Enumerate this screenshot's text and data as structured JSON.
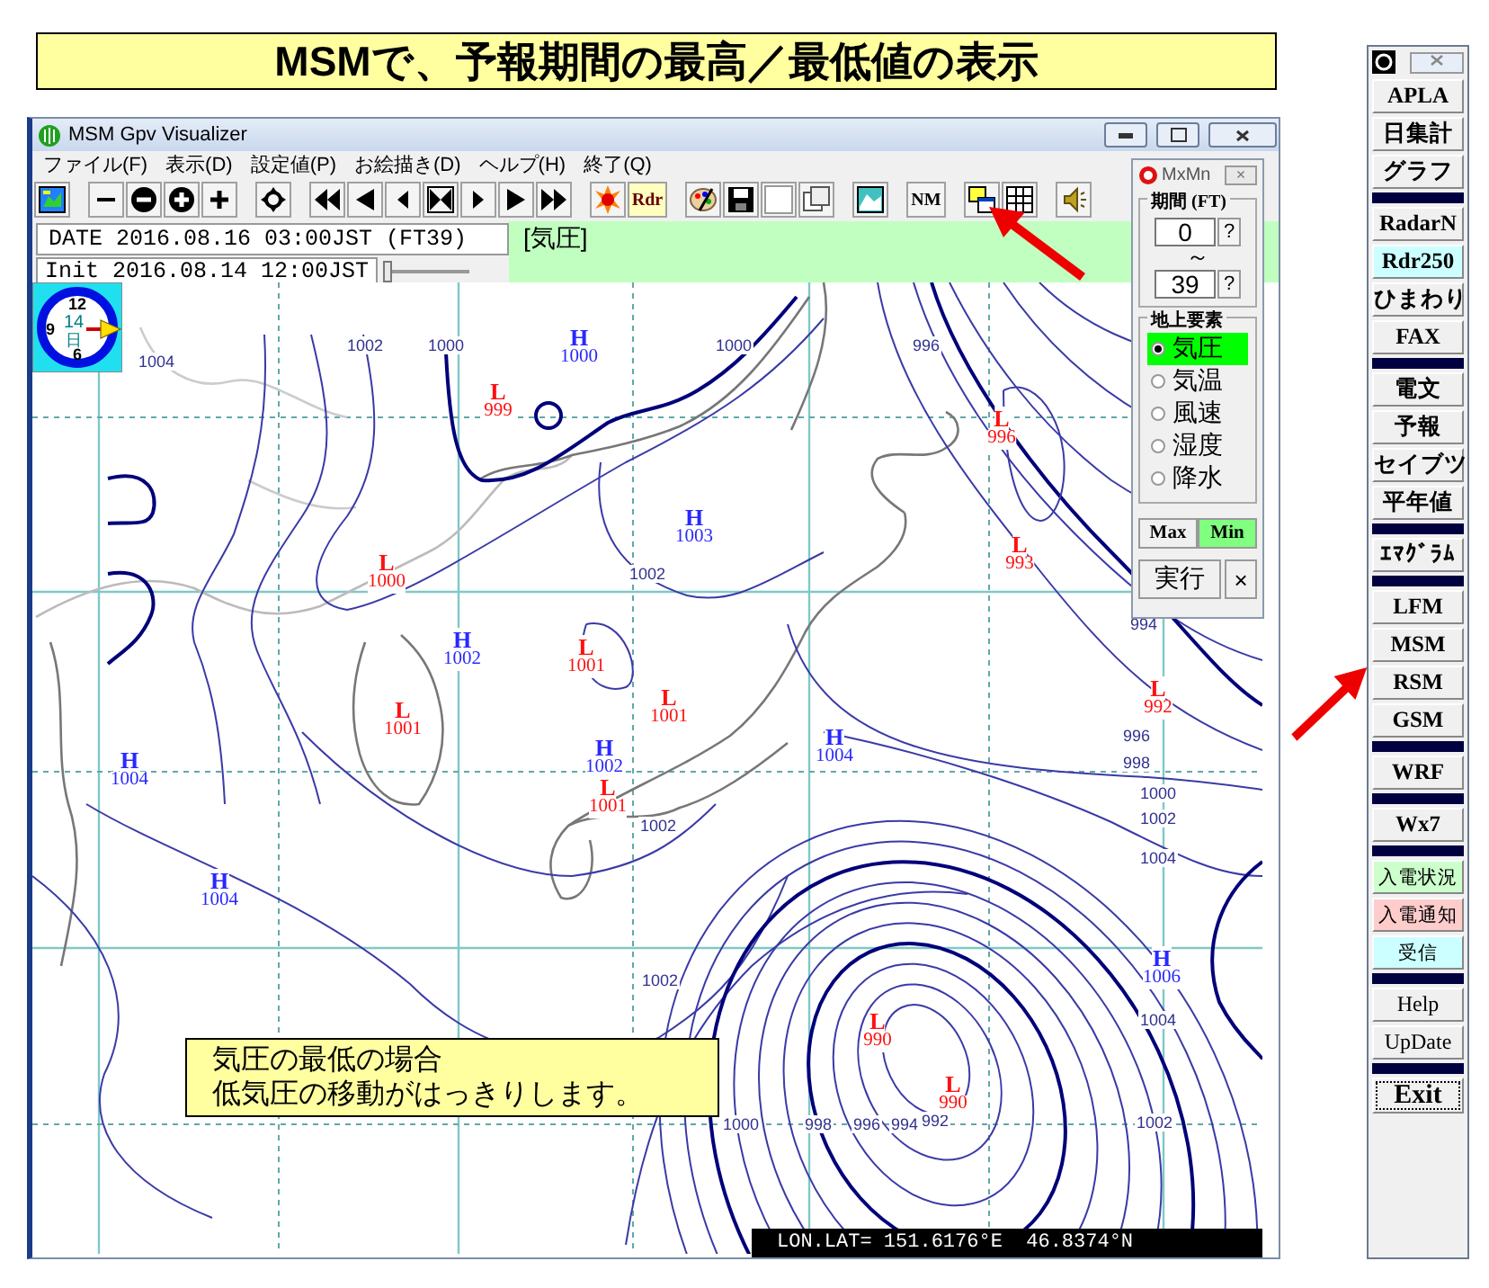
{
  "banner": {
    "title": "MSMで、予報期間の最高／最低値の表示"
  },
  "window": {
    "title": "MSM Gpv Visualizer"
  },
  "menu": [
    "ファイル(F)",
    "表示(D)",
    "設定値(P)",
    "お絵描き(D)",
    "ヘルプ(H)",
    "終了(Q)"
  ],
  "toolbar": {
    "radar_button": "Rdr",
    "nm_button": "NM"
  },
  "header": {
    "date": "DATE 2016.08.16 03:00JST (FT39)",
    "init": "Init 2016.08.14 12:00JST",
    "slider": {
      "level": 0.05
    },
    "element": "[気圧]"
  },
  "map": {
    "clock": {
      "numerals": [
        "12",
        "9",
        "6"
      ],
      "day": "14",
      "day_unit": "日"
    },
    "pressure_centers": [
      {
        "kind": "H",
        "value": "1000"
      },
      {
        "kind": "L",
        "value": "999"
      },
      {
        "kind": "L",
        "value": "996"
      },
      {
        "kind": "H",
        "value": "1003"
      },
      {
        "kind": "L",
        "value": "993"
      },
      {
        "kind": "L",
        "value": "1000"
      },
      {
        "kind": "H",
        "value": "1002"
      },
      {
        "kind": "L",
        "value": "1001"
      },
      {
        "kind": "L",
        "value": "992"
      },
      {
        "kind": "L",
        "value": "1001"
      },
      {
        "kind": "L",
        "value": "1001"
      },
      {
        "kind": "H",
        "value": "1004"
      },
      {
        "kind": "H",
        "value": "1002"
      },
      {
        "kind": "H",
        "value": "1004"
      },
      {
        "kind": "L",
        "value": "1001"
      },
      {
        "kind": "H",
        "value": "1004"
      },
      {
        "kind": "H",
        "value": "1006"
      },
      {
        "kind": "L",
        "value": "990"
      },
      {
        "kind": "L",
        "value": "990"
      }
    ],
    "isobar_labels": [
      "1002",
      "1000",
      "1000",
      "996",
      "1004",
      "1002",
      "994",
      "996",
      "998",
      "1000",
      "1002",
      "1002",
      "1004",
      "1002",
      "1004",
      "1000",
      "998",
      "996",
      "994",
      "992",
      "1002"
    ],
    "note": [
      "気圧の最低の場合",
      "低気圧の移動がはっきりします。"
    ],
    "coordinates": "LON.LAT= 151.6176°E  46.8374°N"
  },
  "mxmn": {
    "title": "MxMn",
    "close_button": "×",
    "period": {
      "label": "期間 (FT)",
      "tilde": "～",
      "fields": [
        {
          "value": "0",
          "button": "?"
        },
        {
          "value": "39",
          "button": "?"
        }
      ]
    },
    "elements": {
      "label": "地上要素",
      "options": [
        {
          "label": "気圧",
          "selected": true
        },
        {
          "label": "気温",
          "selected": false
        },
        {
          "label": "風速",
          "selected": false
        },
        {
          "label": "湿度",
          "selected": false
        },
        {
          "label": "降水",
          "selected": false
        }
      ]
    },
    "modes": [
      {
        "label": "Max",
        "selected": false
      },
      {
        "label": "Min",
        "selected": true
      }
    ],
    "run_button": "実行",
    "cancel_button": "×"
  },
  "sidebar": {
    "groups": [
      {
        "kind": "tools",
        "buttons": [
          {
            "label": "APLA",
            "focused": false
          },
          {
            "label": "日集計",
            "focused": false
          },
          {
            "label": "グラフ",
            "focused": false
          }
        ]
      },
      {
        "kind": "tools",
        "buttons": [
          {
            "label": "RadarN",
            "focused": false
          },
          {
            "label": "Rdr250",
            "focused": false,
            "color": "#ccffff"
          },
          {
            "label": "ひまわり",
            "focused": false
          },
          {
            "label": "FAX",
            "focused": false
          }
        ]
      },
      {
        "kind": "tools",
        "buttons": [
          {
            "label": "電文",
            "focused": false
          },
          {
            "label": "予報",
            "focused": false
          },
          {
            "label": "セイブツ",
            "focused": false
          },
          {
            "label": "平年値",
            "focused": false
          }
        ]
      },
      {
        "kind": "tools",
        "buttons": [
          {
            "label": "ｴﾏｸﾞﾗﾑ",
            "focused": false
          }
        ]
      },
      {
        "kind": "tools",
        "buttons": [
          {
            "label": "LFM",
            "focused": false
          },
          {
            "label": "MSM",
            "focused": false
          },
          {
            "label": "RSM",
            "focused": false
          },
          {
            "label": "GSM",
            "focused": false
          }
        ]
      },
      {
        "kind": "tools",
        "buttons": [
          {
            "label": "WRF",
            "focused": false
          }
        ]
      },
      {
        "kind": "tools",
        "buttons": [
          {
            "label": "Wx7",
            "focused": false
          }
        ]
      },
      {
        "kind": "status",
        "buttons": [
          {
            "label": "入電状況",
            "focused": false,
            "color": "#ccffcc"
          },
          {
            "label": "入電通知",
            "focused": false,
            "color": "#ffcccc"
          },
          {
            "label": "受信",
            "focused": false,
            "color": "#ccffff"
          }
        ]
      },
      {
        "kind": "utility",
        "buttons": [
          {
            "label": "Help",
            "focused": false
          },
          {
            "label": "UpDate",
            "focused": false
          }
        ]
      },
      {
        "kind": "exit",
        "buttons": [
          {
            "label": "Exit",
            "focused": true
          }
        ]
      }
    ]
  }
}
